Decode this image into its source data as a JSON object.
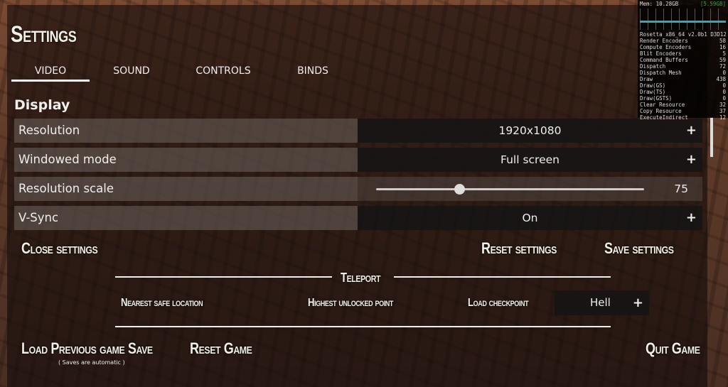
{
  "title": "Settings",
  "tabs": [
    {
      "label": "VIDEO",
      "active": true
    },
    {
      "label": "SOUND"
    },
    {
      "label": "CONTROLS"
    },
    {
      "label": "BINDS"
    }
  ],
  "section": "Display",
  "rows": {
    "resolution": {
      "label": "Resolution",
      "value": "1920x1080"
    },
    "windowed": {
      "label": "Windowed mode",
      "value": "Full screen"
    },
    "scale": {
      "label": "Resolution scale",
      "value": "75",
      "fill": 0.31
    },
    "vsync": {
      "label": "V-Sync",
      "value": "On"
    }
  },
  "plus": "+",
  "buttons": {
    "close": "Close settings",
    "reset": "Reset settings",
    "save": "Save settings",
    "load": "Load Previous game Save",
    "reset_game": "Reset Game",
    "quit": "Quit Game"
  },
  "saves_hint": "( Saves are automatic )",
  "teleport": {
    "title": "Teleport",
    "nearest": "Nearest safe location",
    "highest": "Highest unlocked point",
    "checkpoint_label": "Load checkpoint",
    "checkpoint_value": "Hell"
  },
  "perf": {
    "mem_label": "Mem:",
    "mem_value": "10.28GB",
    "mem_extra": "[5.59GB]",
    "header": "Rosetta x86_64 v2.0b1 D3D12",
    "stats": [
      [
        "Render Encoders",
        "58"
      ],
      [
        "Compute Encoders",
        "16"
      ],
      [
        "Blit Encoders",
        "5"
      ],
      [
        "Command Buffers",
        "59"
      ],
      [
        "Dispatch",
        "72"
      ],
      [
        "Dispatch Mesh",
        "0"
      ],
      [
        "Draw",
        "438"
      ],
      [
        "Draw(GS)",
        "0"
      ],
      [
        "Draw(TS)",
        "0"
      ],
      [
        "Draw(GSTS)",
        "0"
      ],
      [
        "Clear Resource",
        "32"
      ],
      [
        "Copy Resource",
        "37"
      ],
      [
        "ExecuteIndirect",
        "12"
      ]
    ]
  },
  "colors": {
    "perf_graph": "#3aa3b8",
    "mem_extra": "#3c9a4a"
  }
}
